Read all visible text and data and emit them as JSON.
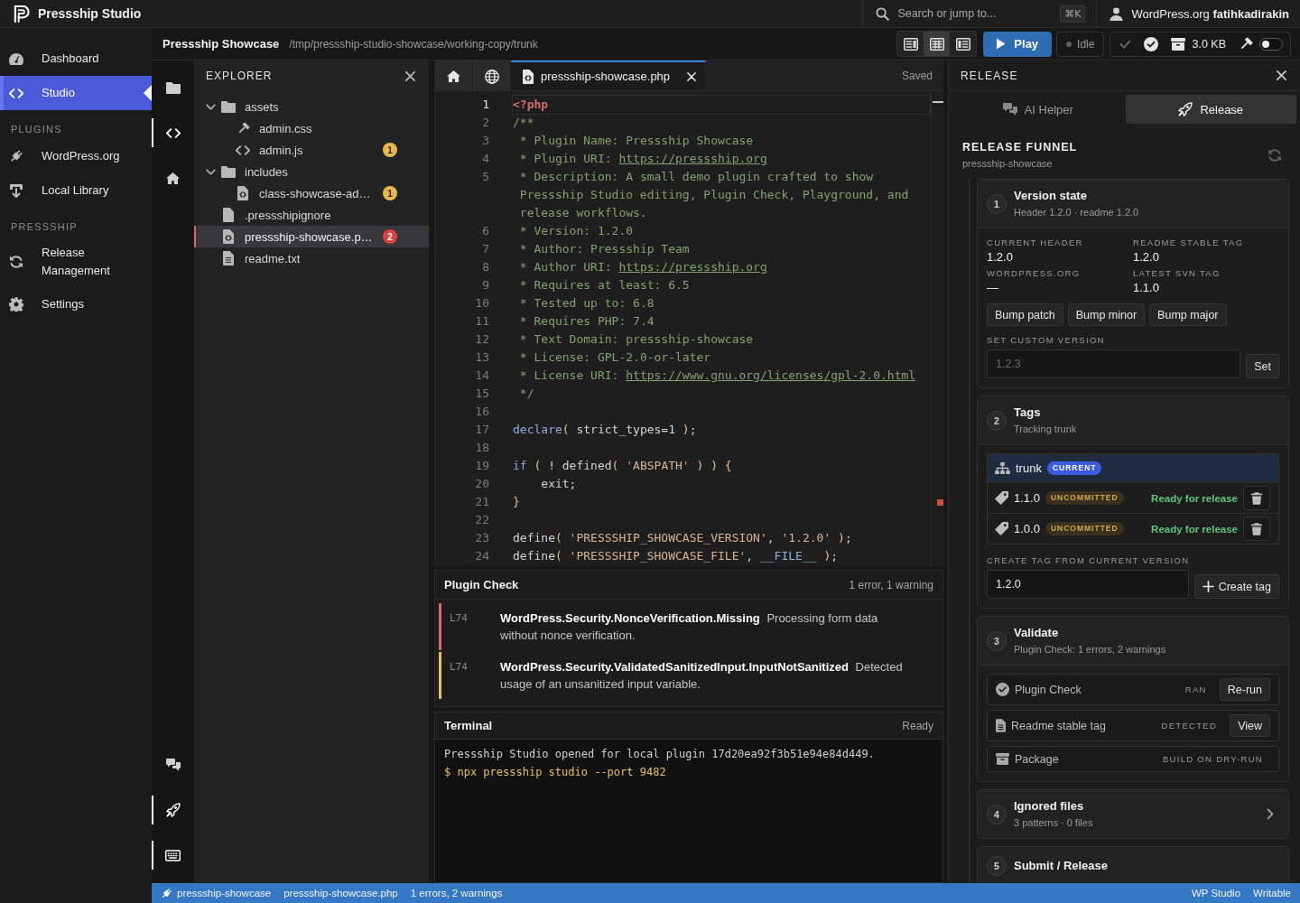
{
  "app": {
    "title": "Pressship Studio"
  },
  "search": {
    "placeholder": "Search or jump to...",
    "shortcut": "⌘K"
  },
  "account": {
    "label": "WordPress.org **fatihkadirakin**"
  },
  "nav": {
    "sections": [
      {
        "items": [
          {
            "label": "Dashboard",
            "selected": false
          },
          {
            "label": "Studio",
            "selected": true
          }
        ]
      },
      {
        "heading": "PLUGINS",
        "items": [
          {
            "label": "WordPress.org",
            "selected": false
          },
          {
            "label": "Local Library",
            "selected": false
          }
        ]
      },
      {
        "heading": "PRESSSHIP",
        "items": [
          {
            "label": "Release Management",
            "selected": false
          },
          {
            "label": "Settings",
            "selected": false
          }
        ]
      }
    ]
  },
  "project": {
    "name": "Pressship Showcase",
    "path": "/tmp/pressship-studio-showcase/working-copy/trunk"
  },
  "toolbar": {
    "layouts": [
      {
        "selected": false
      },
      {
        "selected": true
      },
      {
        "selected": false
      }
    ],
    "play": "Play",
    "run_state": "Idle",
    "size": "3.0 KB",
    "toggle": {
      "on": false
    }
  },
  "activity_bar": {
    "top": [
      {
        "selected": false
      },
      {
        "selected": true
      },
      {
        "selected": false
      }
    ],
    "bottom": [
      {
        "selected": false
      },
      {
        "selected": true
      },
      {
        "selected": true
      }
    ]
  },
  "explorer": {
    "title": "EXPLORER",
    "tree": [
      {
        "name": "assets",
        "kind": "folder",
        "expanded": true,
        "selected": false,
        "children": [
          {
            "name": "admin.css",
            "kind": "style",
            "selected": false
          },
          {
            "name": "admin.js",
            "kind": "script",
            "selected": false,
            "badge": {
              "count": "1",
              "color": "#e8b84b"
            }
          }
        ]
      },
      {
        "name": "includes",
        "kind": "folder",
        "expanded": true,
        "selected": false,
        "children": [
          {
            "name": "class-showcase-ad…",
            "kind": "code",
            "selected": false,
            "badge": {
              "count": "1",
              "color": "#e8b84b"
            }
          }
        ]
      },
      {
        "name": ".pressshipignore",
        "kind": "file",
        "selected": false
      },
      {
        "name": "pressship-showcase.p…",
        "kind": "code",
        "selected": true,
        "badge": {
          "count": "2",
          "color": "#d64541"
        }
      },
      {
        "name": "readme.txt",
        "kind": "text",
        "selected": false
      }
    ]
  },
  "editor": {
    "tabs": [
      {
        "kind": "home",
        "selected": false
      },
      {
        "kind": "globe",
        "selected": false
      },
      {
        "kind": "file",
        "label": "pressship-showcase.php",
        "selected": true
      }
    ],
    "save_state": "Saved",
    "lines": [
      {
        "number": "1",
        "current": true,
        "segments": [
          {
            "kind": "tag",
            "text": "<?php"
          }
        ]
      },
      {
        "number": "2",
        "current": false,
        "segments": [
          {
            "kind": "comment",
            "text": "/**"
          }
        ]
      },
      {
        "number": "3",
        "current": false,
        "segments": [
          {
            "kind": "comment",
            "text": " * Plugin Name: Pressship Showcase"
          }
        ]
      },
      {
        "number": "4",
        "current": false,
        "segments": [
          {
            "kind": "comment",
            "text": " * Plugin URI: "
          },
          {
            "kind": "link",
            "text": "https://pressship.org"
          }
        ]
      },
      {
        "number": "5",
        "current": false,
        "segments": [
          {
            "kind": "comment",
            "text": " * Description: A small demo plugin crafted to show Pressship Studio editing, Plugin Check, Playground, and release workflows."
          }
        ]
      },
      {
        "number": "6",
        "current": false,
        "segments": [
          {
            "kind": "comment",
            "text": " * Version: 1.2.0"
          }
        ]
      },
      {
        "number": "7",
        "current": false,
        "segments": [
          {
            "kind": "comment",
            "text": " * Author: Pressship Team"
          }
        ]
      },
      {
        "number": "8",
        "current": false,
        "segments": [
          {
            "kind": "comment",
            "text": " * Author URI: "
          },
          {
            "kind": "link",
            "text": "https://pressship.org"
          }
        ]
      },
      {
        "number": "9",
        "current": false,
        "segments": [
          {
            "kind": "comment",
            "text": " * Requires at least: 6.5"
          }
        ]
      },
      {
        "number": "10",
        "current": false,
        "segments": [
          {
            "kind": "comment",
            "text": " * Tested up to: 6.8"
          }
        ]
      },
      {
        "number": "11",
        "current": false,
        "segments": [
          {
            "kind": "comment",
            "text": " * Requires PHP: 7.4"
          }
        ]
      },
      {
        "number": "12",
        "current": false,
        "segments": [
          {
            "kind": "comment",
            "text": " * Text Domain: pressship-showcase"
          }
        ]
      },
      {
        "number": "13",
        "current": false,
        "segments": [
          {
            "kind": "comment",
            "text": " * License: GPL-2.0-or-later"
          }
        ]
      },
      {
        "number": "14",
        "current": false,
        "segments": [
          {
            "kind": "comment",
            "text": " * License URI: "
          },
          {
            "kind": "link",
            "text": "https://www.gnu.org/licenses/gpl-2.0.html"
          }
        ]
      },
      {
        "number": "15",
        "current": false,
        "segments": [
          {
            "kind": "comment",
            "text": " */"
          }
        ]
      },
      {
        "number": "16",
        "current": false
      },
      {
        "number": "17",
        "current": false,
        "segments": [
          {
            "kind": "keyword",
            "text": "declare"
          },
          {
            "kind": "punct",
            "text": "("
          },
          {
            "kind": "plain",
            "text": " strict_types=1 "
          },
          {
            "kind": "punct",
            "text": ")"
          },
          {
            "kind": "plain",
            "text": ";"
          }
        ]
      },
      {
        "number": "18",
        "current": false
      },
      {
        "number": "19",
        "current": false,
        "segments": [
          {
            "kind": "keyword",
            "text": "if"
          },
          {
            "kind": "punct",
            "text": " ("
          },
          {
            "kind": "plain",
            "text": " ! defined"
          },
          {
            "kind": "punct",
            "text": "("
          },
          {
            "kind": "string",
            "text": " 'ABSPATH'"
          },
          {
            "kind": "punct",
            "text": " )"
          },
          {
            "kind": "punct",
            "text": " )"
          },
          {
            "kind": "punct",
            "text": " {"
          }
        ]
      },
      {
        "number": "20",
        "current": false,
        "segments": [
          {
            "kind": "plain",
            "text": "    exit;"
          }
        ]
      },
      {
        "number": "21",
        "current": false,
        "segments": [
          {
            "kind": "punct",
            "text": "}"
          }
        ]
      },
      {
        "number": "22",
        "current": false
      },
      {
        "number": "23",
        "current": false,
        "segments": [
          {
            "kind": "plain",
            "text": "define"
          },
          {
            "kind": "punct",
            "text": "("
          },
          {
            "kind": "string",
            "text": " 'PRESSSHIP_SHOWCASE_VERSION'"
          },
          {
            "kind": "plain",
            "text": ", "
          },
          {
            "kind": "string",
            "text": "'1.2.0'"
          },
          {
            "kind": "punct",
            "text": " )"
          },
          {
            "kind": "plain",
            "text": ";"
          }
        ]
      },
      {
        "number": "24",
        "current": false,
        "segments": [
          {
            "kind": "plain",
            "text": "define"
          },
          {
            "kind": "punct",
            "text": "("
          },
          {
            "kind": "string",
            "text": " 'PRESSSHIP_SHOWCASE_FILE'"
          },
          {
            "kind": "plain",
            "text": ", "
          },
          {
            "kind": "keyword",
            "text": "__FILE__"
          },
          {
            "kind": "punct",
            "text": " )"
          },
          {
            "kind": "plain",
            "text": ";"
          }
        ]
      }
    ]
  },
  "plugin_check": {
    "title": "Plugin Check",
    "summary": "1 error, 1 warning",
    "items": [
      {
        "line": "L74",
        "kind": "error",
        "message": "**WordPress.Security.NonceVerification.Missing** Processing form data without nonce verification."
      },
      {
        "line": "L74",
        "kind": "warning",
        "message": "**WordPress.Security.ValidatedSanitizedInput.InputNotSanitized** Detected usage of an unsanitized input variable."
      }
    ]
  },
  "terminal": {
    "title": "Terminal",
    "state": "Ready",
    "lines": [
      {
        "kind": "output",
        "text": "Pressship Studio opened for local plugin 17d20ea92f3b51e94e84d449."
      },
      {
        "kind": "command",
        "text": "$ npx pressship studio --port 9482"
      }
    ]
  },
  "release_panel": {
    "title": "RELEASE",
    "tabs": [
      {
        "label": "AI Helper",
        "selected": false
      },
      {
        "label": "Release",
        "selected": true
      }
    ],
    "funnel": {
      "title": "RELEASE FUNNEL",
      "subtitle": "pressship-showcase",
      "steps": [
        {
          "number": "1",
          "title": "Version state",
          "subtitle": "Header 1.2.0 · readme 1.2.0",
          "expanded": true,
          "facts": [
            {
              "label": "CURRENT HEADER",
              "value": "1.2.0"
            },
            {
              "label": "README STABLE TAG",
              "value": "1.2.0"
            },
            {
              "label": "WORDPRESS.ORG",
              "value": "—"
            },
            {
              "label": "LATEST SVN TAG",
              "value": "1.1.0"
            }
          ],
          "buttons": [
            "Bump patch",
            "Bump minor",
            "Bump major"
          ],
          "custom_version": {
            "label": "SET CUSTOM VERSION",
            "placeholder": "1.2.3",
            "button": "Set"
          }
        },
        {
          "number": "2",
          "title": "Tags",
          "subtitle": "Tracking trunk",
          "expanded": true,
          "tags": [
            {
              "name": "trunk",
              "kind": "branch",
              "badge": "CURRENT",
              "selected": true
            },
            {
              "name": "1.1.0",
              "kind": "tag",
              "badge": "UNCOMMITTED",
              "status": "Ready for release",
              "selected": false
            },
            {
              "name": "1.0.0",
              "kind": "tag",
              "badge": "UNCOMMITTED",
              "status": "Ready for release",
              "selected": false
            }
          ],
          "create_tag": {
            "label": "CREATE TAG FROM CURRENT VERSION",
            "value": "1.2.0",
            "button": "Create tag"
          }
        },
        {
          "number": "3",
          "title": "Validate",
          "subtitle": "Plugin Check: 1 errors, 2 warnings",
          "expanded": true,
          "checks": [
            {
              "label": "Plugin Check",
              "kind": "check",
              "status": "RAN",
              "button": "Re-run"
            },
            {
              "label": "Readme stable tag",
              "kind": "document",
              "status": "DETECTED",
              "button": "View"
            },
            {
              "label": "Package",
              "kind": "package",
              "status": "BUILD ON DRY-RUN"
            }
          ]
        },
        {
          "number": "4",
          "title": "Ignored files",
          "subtitle": "3 patterns · 0 files",
          "expanded": false
        },
        {
          "number": "5",
          "title": "Submit / Release"
        }
      ]
    }
  },
  "status_bar": {
    "left": [
      "pressship-showcase",
      "pressship-showcase.php",
      "1 errors, 2 warnings"
    ],
    "right": [
      "WP Studio",
      "Writable"
    ]
  }
}
